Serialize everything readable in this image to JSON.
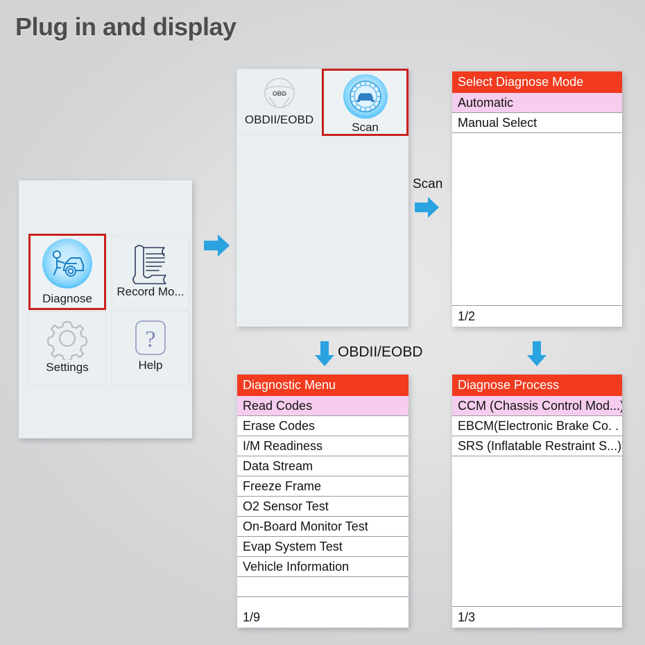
{
  "page": {
    "title": "Plug in and display"
  },
  "colors": {
    "header_red": "#f13a1e",
    "highlight_pink": "#f6cdee",
    "selection_border": "#c9211e",
    "arrow_blue": "#2aa3e0",
    "device_bg": "#e9eef0",
    "page_bg": "#d8d9da"
  },
  "main_menu": {
    "tiles": [
      {
        "label": "Diagnose",
        "icon": "mechanic-car-icon",
        "selected": true
      },
      {
        "label": "Record Mo...",
        "icon": "document-scroll-icon",
        "selected": false
      },
      {
        "label": "Settings",
        "icon": "gear-icon",
        "selected": false
      },
      {
        "label": "Help",
        "icon": "question-mark-icon",
        "selected": false
      }
    ]
  },
  "diagnose_menu": {
    "tiles": [
      {
        "label": "OBDII/EOBD",
        "icon": "steering-wheel-icon",
        "icon_text": "OBD",
        "selected": false
      },
      {
        "label": "Scan",
        "icon": "car-scan-icon",
        "selected": true
      }
    ]
  },
  "select_diagnose_mode": {
    "header": "Select Diagnose Mode",
    "items": [
      {
        "label": "Automatic",
        "highlighted": true
      },
      {
        "label": "Manual Select",
        "highlighted": false
      }
    ],
    "footer": "1/2"
  },
  "diagnostic_menu": {
    "header": "Diagnostic Menu",
    "items": [
      {
        "label": "Read Codes",
        "highlighted": true
      },
      {
        "label": "Erase Codes",
        "highlighted": false
      },
      {
        "label": "I/M Readiness",
        "highlighted": false
      },
      {
        "label": "Data Stream",
        "highlighted": false
      },
      {
        "label": "Freeze Frame",
        "highlighted": false
      },
      {
        "label": "O2 Sensor Test",
        "highlighted": false
      },
      {
        "label": "On-Board Monitor Test",
        "highlighted": false
      },
      {
        "label": "Evap System Test",
        "highlighted": false
      },
      {
        "label": "Vehicle Information",
        "highlighted": false
      },
      {
        "label": "",
        "highlighted": false
      }
    ],
    "footer": "1/9"
  },
  "diagnose_process": {
    "header": "Diagnose Process",
    "items": [
      {
        "label": "CCM (Chassis Control Mod...)",
        "highlighted": true
      },
      {
        "label": "EBCM(Electronic Brake Co. . . )",
        "highlighted": false
      },
      {
        "label": "SRS (Inflatable Restraint S...)",
        "highlighted": false
      }
    ],
    "footer": "1/3"
  },
  "flow": {
    "arrow_1": {
      "direction": "right",
      "label": ""
    },
    "arrow_2": {
      "direction": "right",
      "label": "Scan"
    },
    "arrow_3": {
      "direction": "down",
      "label": "OBDII/EOBD"
    },
    "arrow_4": {
      "direction": "down",
      "label": ""
    }
  }
}
